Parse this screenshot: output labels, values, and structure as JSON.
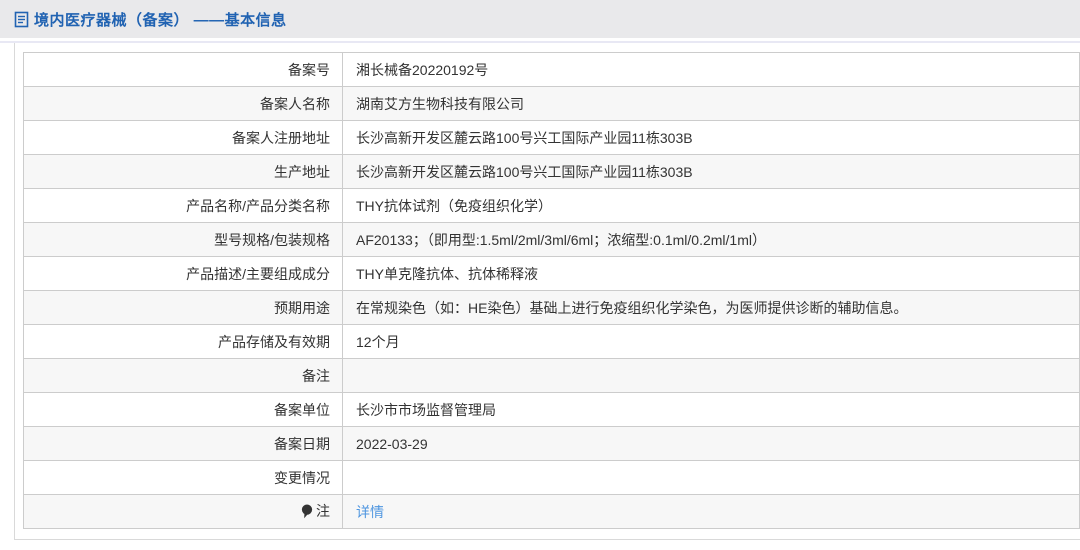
{
  "colors": {
    "header_bg": "#e9e9eb",
    "accent_blue": "#2163b2",
    "link_blue": "#4f96e0",
    "table_border": "#cccccc",
    "alt_row_bg": "#f7f7f7",
    "text": "#333333"
  },
  "header": {
    "title": "境内医疗器械（备案） ——基本信息",
    "icon": "document-icon"
  },
  "table": {
    "rows": [
      {
        "label": "备案号",
        "value": "湘长械备20220192号"
      },
      {
        "label": "备案人名称",
        "value": "湖南艾方生物科技有限公司"
      },
      {
        "label": "备案人注册地址",
        "value": "长沙高新开发区麓云路100号兴工国际产业园11栋303B"
      },
      {
        "label": "生产地址",
        "value": "长沙高新开发区麓云路100号兴工国际产业园11栋303B"
      },
      {
        "label": "产品名称/产品分类名称",
        "value": "THY抗体试剂（免疫组织化学）"
      },
      {
        "label": "型号规格/包装规格",
        "value": "AF20133；（即用型:1.5ml/2ml/3ml/6ml；浓缩型:0.1ml/0.2ml/1ml）"
      },
      {
        "label": "产品描述/主要组成成分",
        "value": "THY单克隆抗体、抗体稀释液"
      },
      {
        "label": "预期用途",
        "value": "在常规染色（如：HE染色）基础上进行免疫组织化学染色，为医师提供诊断的辅助信息。"
      },
      {
        "label": "产品存储及有效期",
        "value": "12个月"
      },
      {
        "label": "备注",
        "value": ""
      },
      {
        "label": "备案单位",
        "value": "长沙市市场监督管理局"
      },
      {
        "label": "备案日期",
        "value": "2022-03-29"
      },
      {
        "label": "变更情况",
        "value": ""
      },
      {
        "label": "注",
        "value": "详情",
        "icon": "balloon-icon",
        "value_is_link": true
      }
    ]
  }
}
